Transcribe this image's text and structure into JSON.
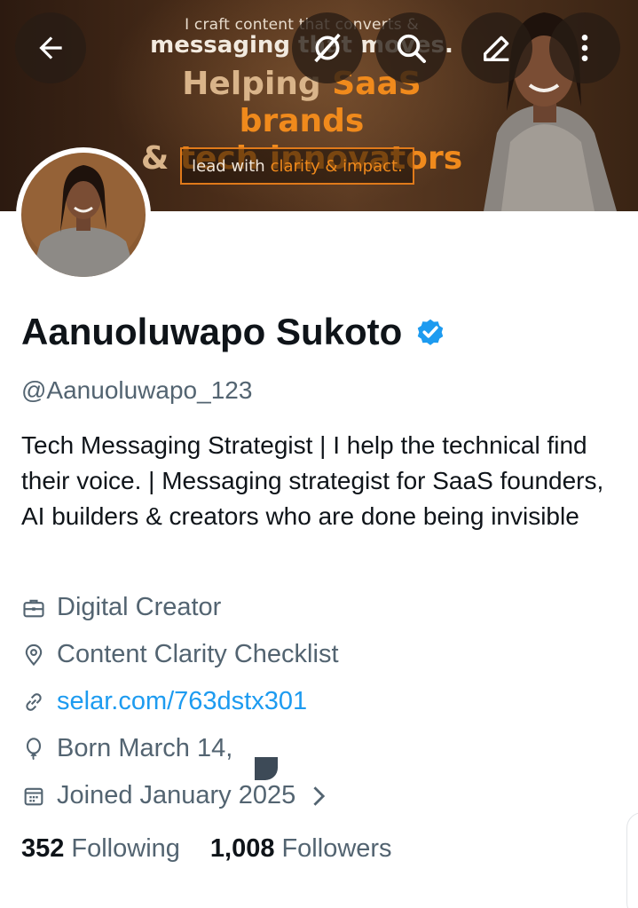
{
  "banner": {
    "line1": "I craft content that converts &",
    "line2": "messaging that moves.",
    "headline1_a": "Helping ",
    "headline1_b": "SaaS brands",
    "headline2_a": "& ",
    "headline2_b": "tech innovators",
    "pill_a": "lead with",
    "pill_b": "clarity & impact."
  },
  "icons": {
    "back": "arrow-left-icon",
    "grok": "grok-icon",
    "search": "search-icon",
    "edit": "edit-icon",
    "more": "more-vertical-icon"
  },
  "profile": {
    "name": "Aanuoluwapo Sukoto",
    "verified": true,
    "handle": "@Aanuoluwapo_123",
    "bio": "Tech Messaging Strategist | I help the technical find their voice. | Messaging strategist for SaaS founders, AI builders & creators who are done being invisible",
    "category": "Digital Creator",
    "location": "Content Clarity Checklist",
    "website": "selar.com/763dstx301",
    "birthday": "Born March 14, ",
    "joined": "Joined January 2025"
  },
  "stats": {
    "following_count": "352",
    "following_label": "Following",
    "followers_count": "1,008",
    "followers_label": "Followers"
  },
  "colors": {
    "accent": "#1d9bf0",
    "muted": "#536471",
    "banner_orange": "#f08a1c"
  }
}
